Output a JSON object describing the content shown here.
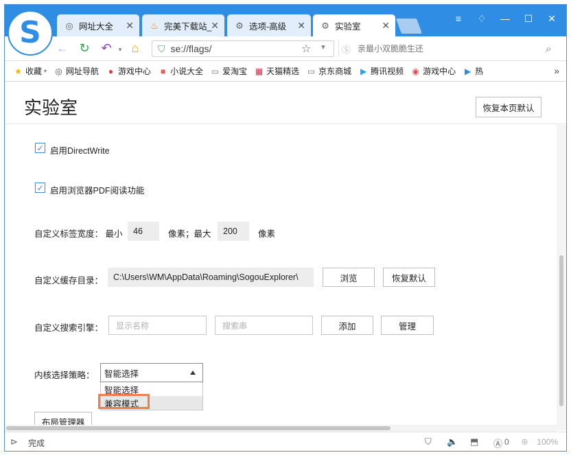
{
  "tabs": [
    {
      "label": "网址大全",
      "icon": "globe-icon",
      "glyph": "◎"
    },
    {
      "label": "完美下载站_",
      "icon": "fire-icon",
      "glyph": "♨"
    },
    {
      "label": "选项-高级",
      "icon": "gear-icon",
      "glyph": "⚙"
    },
    {
      "label": "实验室",
      "icon": "gear-icon",
      "glyph": "⚙"
    }
  ],
  "window_controls": {
    "menu": "≡",
    "skin": "♢",
    "minimize": "—",
    "maximize": "☐",
    "close": "✕"
  },
  "address": {
    "url": "se://flags/"
  },
  "search": {
    "placeholder": "亲最小双脆脆生还"
  },
  "bookmarks": [
    {
      "label": "收藏",
      "icon": "star-icon",
      "glyph": "★",
      "color": "#f0b400"
    },
    {
      "label": "网址导航",
      "icon": "globe-icon",
      "glyph": "◎",
      "color": "#555555"
    },
    {
      "label": "游戏中心",
      "icon": "game-icon",
      "glyph": "●",
      "color": "#e03a3a"
    },
    {
      "label": "小说大全",
      "icon": "book-icon",
      "glyph": "■",
      "color": "#e85a4f"
    },
    {
      "label": "爱淘宝",
      "icon": "page-icon",
      "glyph": "▭",
      "color": "#777777"
    },
    {
      "label": "天猫精选",
      "icon": "tmall-icon",
      "glyph": "▦",
      "color": "#c8304a"
    },
    {
      "label": "京东商城",
      "icon": "page-icon",
      "glyph": "▭",
      "color": "#777777"
    },
    {
      "label": "腾讯视频",
      "icon": "video-icon",
      "glyph": "▶",
      "color": "#2aa4f4"
    },
    {
      "label": "游戏中心",
      "icon": "gamepad-icon",
      "glyph": "◉",
      "color": "#e84a5a"
    },
    {
      "label": "热",
      "icon": "play-icon",
      "glyph": "▶",
      "color": "#2f8ee3"
    }
  ],
  "page": {
    "title": "实验室",
    "reset_page_label": "恢复本页默认"
  },
  "settings": {
    "directwrite": {
      "label": "启用DirectWrite",
      "checked": true
    },
    "pdf_reader": {
      "label": "启用浏览器PDF阅读功能",
      "checked": true
    },
    "tab_width": {
      "label": "自定义标签宽度：  最小",
      "min": "46",
      "mid_label": "像素；最大",
      "max": "200",
      "unit": "像素"
    },
    "cache_dir": {
      "label": "自定义缓存目录：",
      "value": "C:\\Users\\WM\\AppData\\Roaming\\SogouExplorer\\",
      "browse_label": "浏览",
      "reset_label": "恢复默认"
    },
    "search_engine": {
      "label": "自定义搜索引擎：",
      "name_placeholder": "显示名称",
      "query_placeholder": "搜索串",
      "add_label": "添加",
      "manage_label": "管理"
    },
    "kernel": {
      "label": "内核选择策略：",
      "selected": "智能选择",
      "options": [
        "智能选择",
        "兼容模式"
      ]
    },
    "layout_manager_label": "布局管理器"
  },
  "status": {
    "text": "完成",
    "zoom": "100%",
    "counter": "0"
  }
}
